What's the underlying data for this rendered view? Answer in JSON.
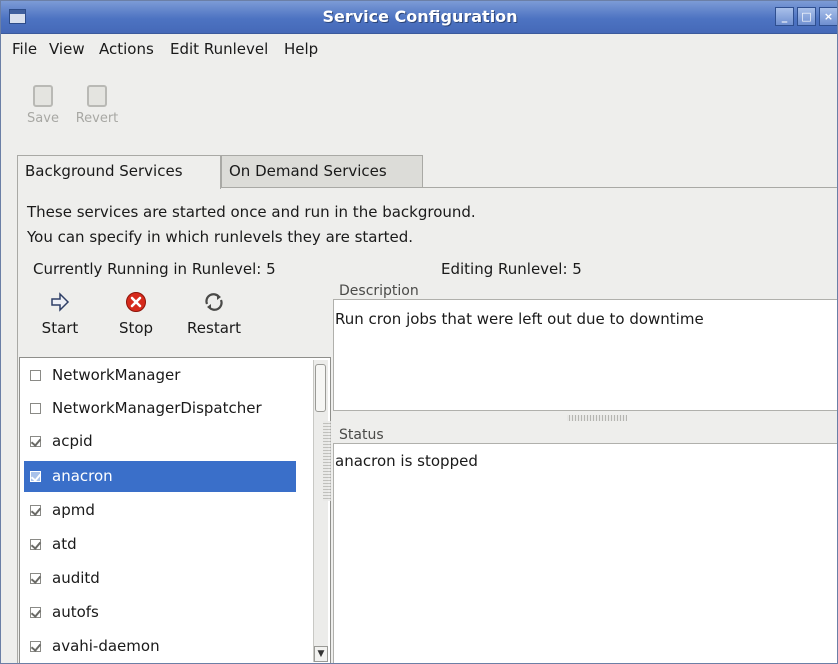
{
  "window": {
    "title": "Service Configuration"
  },
  "menubar": {
    "items": [
      "File",
      "View",
      "Actions",
      "Edit Runlevel",
      "Help"
    ]
  },
  "toolbar": {
    "save_label": "Save",
    "revert_label": "Revert"
  },
  "tabs": [
    {
      "label": "Background Services",
      "active": true
    },
    {
      "label": "On Demand Services",
      "active": false
    }
  ],
  "intro": {
    "line1": "These services are started once and run in the background.",
    "line2": "You can specify in which runlevels they are started."
  },
  "runlevel": {
    "current_text": "Currently Running in Runlevel: 5",
    "editing_text": "Editing Runlevel: 5"
  },
  "service_actions": {
    "start_label": "Start",
    "stop_label": "Stop",
    "restart_label": "Restart"
  },
  "services": [
    {
      "name": "NetworkManager",
      "checked": false,
      "selected": false
    },
    {
      "name": "NetworkManagerDispatcher",
      "checked": false,
      "selected": false
    },
    {
      "name": "acpid",
      "checked": true,
      "selected": false
    },
    {
      "name": "anacron",
      "checked": true,
      "selected": true
    },
    {
      "name": "apmd",
      "checked": true,
      "selected": false
    },
    {
      "name": "atd",
      "checked": true,
      "selected": false
    },
    {
      "name": "auditd",
      "checked": true,
      "selected": false
    },
    {
      "name": "autofs",
      "checked": true,
      "selected": false
    },
    {
      "name": "avahi-daemon",
      "checked": true,
      "selected": false
    }
  ],
  "description": {
    "label": "Description",
    "text": "Run cron jobs that were left out due to downtime"
  },
  "status": {
    "label": "Status",
    "text": "anacron is stopped"
  },
  "colors": {
    "titlebar": "#4d73c2",
    "selection": "#3a6fc9",
    "window_bg": "#eeeeec"
  }
}
